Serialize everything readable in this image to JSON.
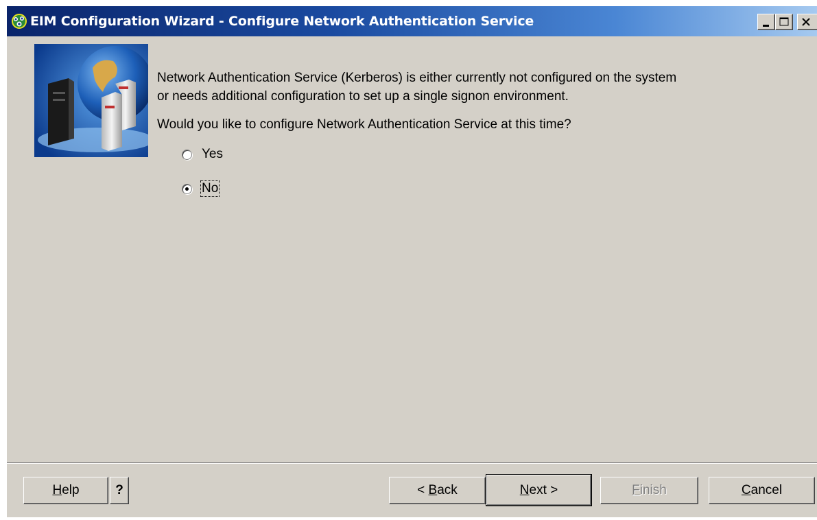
{
  "window": {
    "title": "EIM Configuration Wizard - Configure Network Authentication Service"
  },
  "content": {
    "intro_text": "Network Authentication Service (Kerberos) is either currently not configured on the system\nor needs additional configuration to set up a single signon environment.",
    "question": "Would you like to configure Network Authentication Service at this time?",
    "options": [
      {
        "label": "Yes",
        "selected": false
      },
      {
        "label": "No",
        "selected": true
      }
    ]
  },
  "buttons": {
    "help": {
      "mnemonic": "H",
      "rest": "elp"
    },
    "question": "?",
    "back": {
      "prefix": "< ",
      "mnemonic": "B",
      "rest": "ack"
    },
    "next": {
      "mnemonic": "N",
      "rest": "ext >"
    },
    "finish": {
      "mnemonic": "F",
      "rest": "inish",
      "enabled": false
    },
    "cancel": {
      "mnemonic": "C",
      "rest": "ancel"
    }
  },
  "colors": {
    "dialog_face": "#d4d0c8",
    "titlebar_start": "#0a246a",
    "titlebar_end": "#a6caf0",
    "banner_blue": "#1c4fa8"
  }
}
